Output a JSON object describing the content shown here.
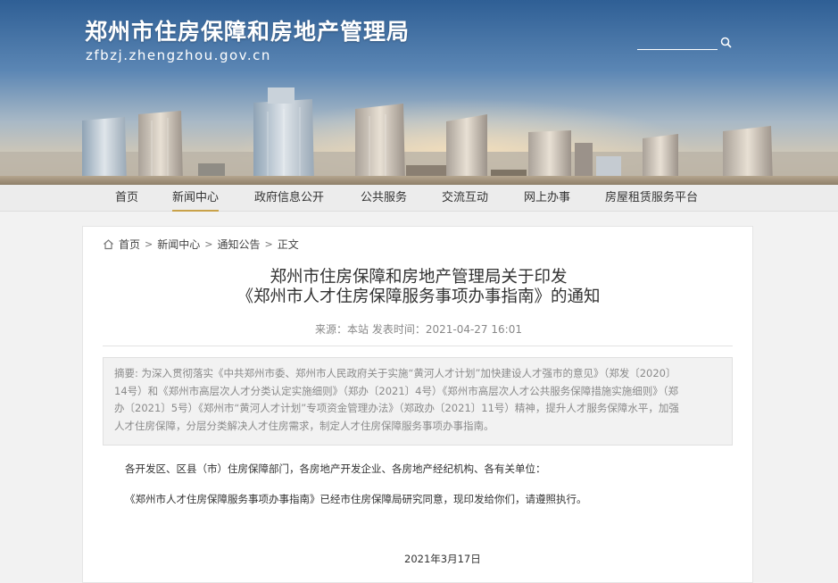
{
  "header": {
    "site_title": "郑州市住房保障和房地产管理局",
    "site_url": "zfbzj.zhengzhou.gov.cn",
    "search_placeholder": ""
  },
  "nav": {
    "items": [
      {
        "label": "首页"
      },
      {
        "label": "新闻中心"
      },
      {
        "label": "政府信息公开"
      },
      {
        "label": "公共服务"
      },
      {
        "label": "交流互动"
      },
      {
        "label": "网上办事"
      },
      {
        "label": "房屋租赁服务平台"
      }
    ],
    "active_index": 1,
    "accent_color": "#c9a24a"
  },
  "breadcrumb": {
    "items": [
      "首页",
      "新闻中心",
      "通知公告",
      "正文"
    ],
    "separator": ">"
  },
  "article": {
    "title_line1": "郑州市住房保障和房地产管理局关于印发",
    "title_line2": "《郑州市人才住房保障服务事项办事指南》的通知",
    "meta": "来源：本站  发表时间：2021-04-27 16:01",
    "abstract_lines": [
      "摘要: 为深入贯彻落实《中共郑州市委、郑州市人民政府关于实施“黄河人才计划”加快建设人才强市的意见》（郑发〔2020〕",
      "14号）和《郑州市高层次人才分类认定实施细则》（郑办〔2021〕4号）《郑州市高层次人才公共服务保障措施实施细则》（郑",
      "办〔2021〕5号）《郑州市“黄河人才计划”专项资金管理办法》（郑政办〔2021〕11号）精神，提升人才服务保障水平，加强",
      "人才住房保障，分层分类解决人才住房需求，制定人才住房保障服务事项办事指南。"
    ],
    "paragraph1": "各开发区、区县（市）住房保障部门，各房地产开发企业、各房地产经纪机构、各有关单位：",
    "paragraph2": "《郑州市人才住房保障服务事项办事指南》已经市住房保障局研究同意，现印发给你们，请遵照执行。",
    "date": "2021年3月17日"
  }
}
